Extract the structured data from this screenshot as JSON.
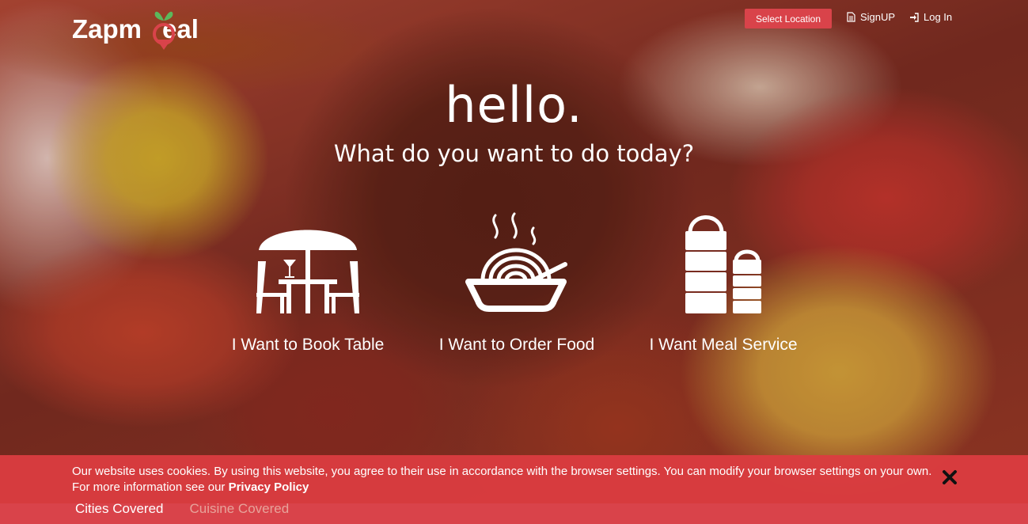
{
  "brand": {
    "name_part1": "Zapm",
    "name_part2": "eal",
    "accent": "#d9434a",
    "leaf_color": "#5cb85c"
  },
  "header": {
    "location_button": "Select Location",
    "signup_label": "SignUP",
    "signup_icon": "document-icon",
    "login_label": "Log In",
    "login_icon": "sign-in-icon"
  },
  "hero": {
    "title": "hello.",
    "subtitle": "What do you want to do today?"
  },
  "options": [
    {
      "label": "I Want to Book Table",
      "icon": "table-umbrella-icon"
    },
    {
      "label": "I Want to Order Food",
      "icon": "noodle-bowl-icon"
    },
    {
      "label": "I Want Meal Service",
      "icon": "tiffin-box-icon"
    }
  ],
  "stats": {
    "cities_label": "Cities Covered",
    "cuisine_label": "Cuisine Covered"
  },
  "cookie": {
    "message": "Our website uses cookies. By using this website, you agree to their use in accordance with the browser settings. You can modify your browser settings on your own. For more information see our",
    "link_label": "Privacy Policy",
    "close_icon": "close-icon"
  }
}
